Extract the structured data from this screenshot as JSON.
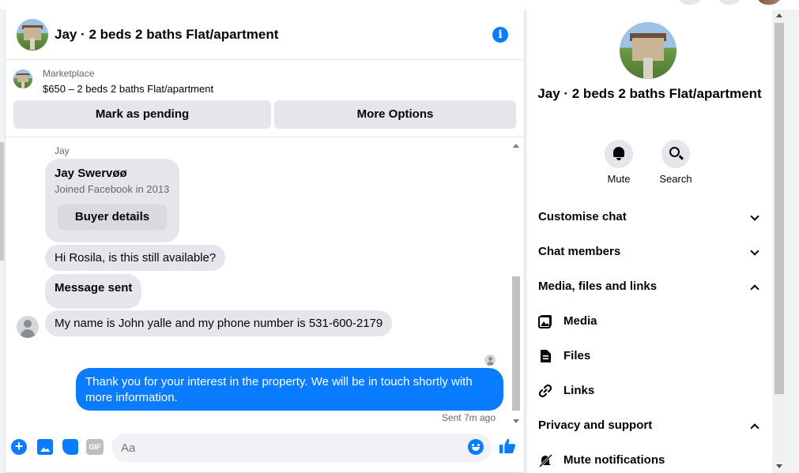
{
  "header": {
    "title": "Jay · 2 beds 2 baths Flat/apartment"
  },
  "marketplace": {
    "label": "Marketplace",
    "listing": "$650 – 2 beds 2 baths Flat/apartment",
    "mark_pending": "Mark as pending",
    "more_options": "More Options"
  },
  "messages": {
    "sender_name": "Jay",
    "card": {
      "name": "Jay Swervøø",
      "joined": "Joined Facebook in 2013",
      "buyer_details": "Buyer details"
    },
    "incoming": [
      "Hi Rosila, is this still available?",
      "Message sent",
      "My name is John yalle and my phone number is 531-600-2179"
    ],
    "outgoing": "Thank you for your interest in the property. We will be in touch shortly with more information.",
    "sent_time": "Sent 7m ago"
  },
  "composer": {
    "placeholder": "Aa",
    "gif_label": "GIF"
  },
  "info_panel": {
    "title": "Jay · 2 beds 2 baths Flat/apartment",
    "actions": [
      "Mute",
      "Search"
    ],
    "sections": [
      {
        "label": "Customise chat",
        "state": "collapsed"
      },
      {
        "label": "Chat members",
        "state": "collapsed"
      },
      {
        "label": "Media, files and links",
        "state": "expanded"
      },
      {
        "label": "Privacy and support",
        "state": "expanded"
      }
    ],
    "media_items": [
      "Media",
      "Files",
      "Links"
    ],
    "privacy_items": [
      "Mute notifications"
    ]
  },
  "colors": {
    "accent": "#0a7cff",
    "bubble_gray": "#e4e6eb"
  }
}
